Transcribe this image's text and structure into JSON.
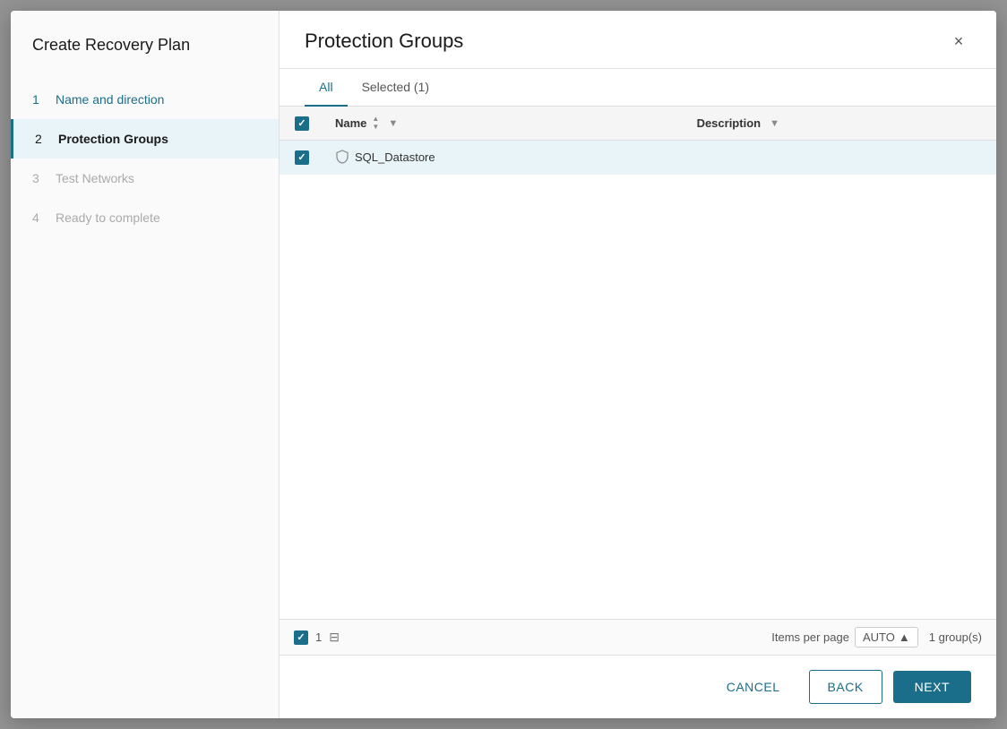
{
  "sidebar": {
    "title": "Create Recovery Plan",
    "steps": [
      {
        "number": "1",
        "label": "Name and direction",
        "state": "completed"
      },
      {
        "number": "2",
        "label": "Protection Groups",
        "state": "active"
      },
      {
        "number": "3",
        "label": "Test Networks",
        "state": "inactive"
      },
      {
        "number": "4",
        "label": "Ready to complete",
        "state": "inactive"
      }
    ]
  },
  "content": {
    "title": "Protection Groups",
    "close_label": "×",
    "tabs": [
      {
        "label": "All",
        "active": true
      },
      {
        "label": "Selected (1)",
        "active": false
      }
    ],
    "table": {
      "columns": [
        {
          "label": "Name",
          "sortable": true,
          "filterable": true
        },
        {
          "label": "Description",
          "sortable": false,
          "filterable": true
        }
      ],
      "rows": [
        {
          "name": "SQL_Datastore",
          "description": "",
          "selected": true
        }
      ]
    },
    "footer": {
      "selected_count": "1",
      "items_per_page_label": "Items per page",
      "items_per_page_value": "AUTO",
      "groups_count": "1 group(s)"
    },
    "buttons": {
      "cancel": "CANCEL",
      "back": "BACK",
      "next": "NEXT"
    }
  }
}
